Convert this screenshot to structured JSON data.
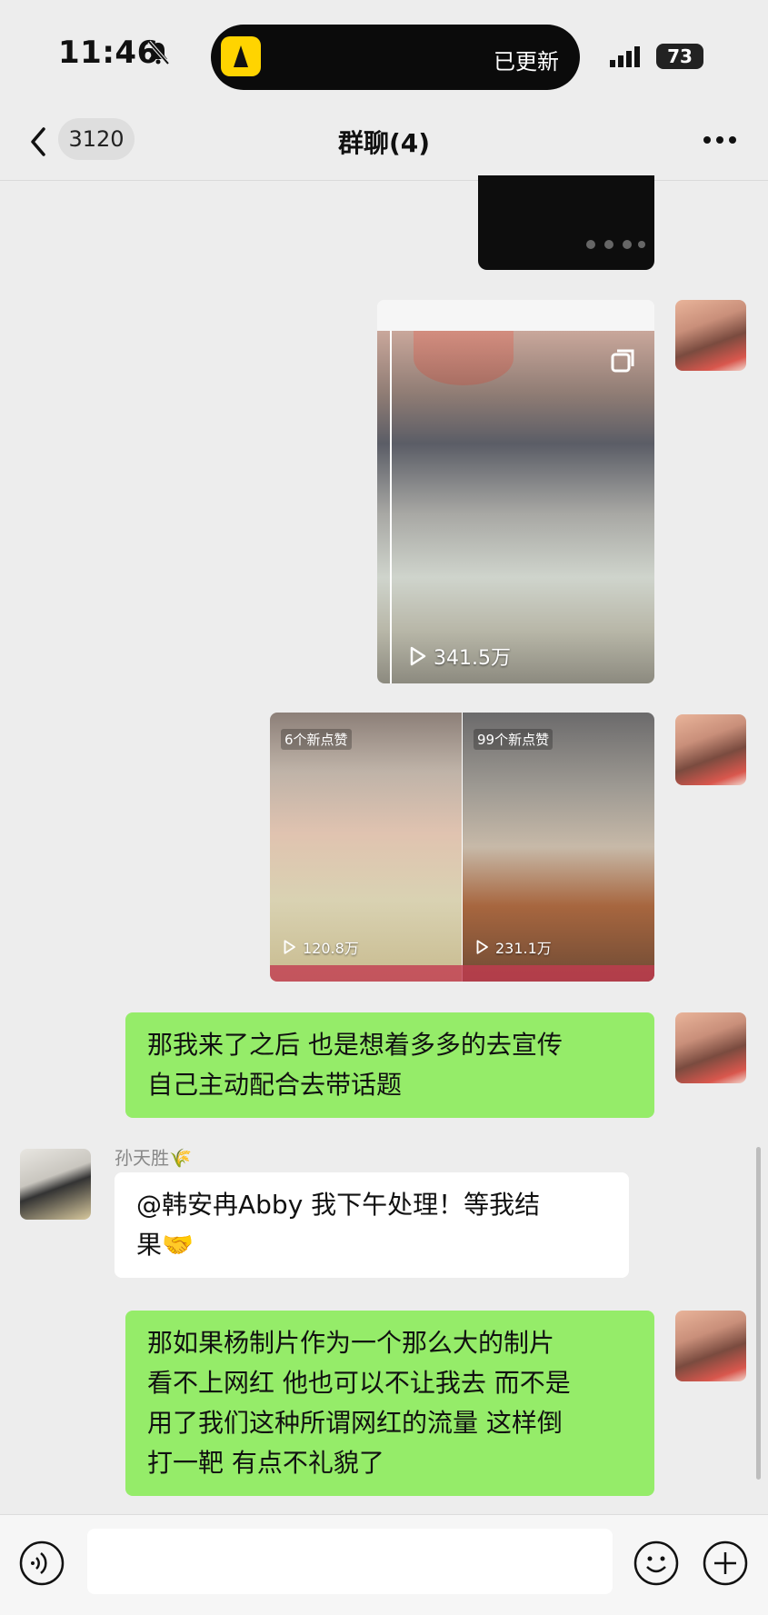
{
  "status": {
    "time": "11:46",
    "island_text": "已更新",
    "battery": "73"
  },
  "nav": {
    "unread_count": "3120",
    "title": "群聊(4)"
  },
  "messages": {
    "video1": {
      "views": "341.5万"
    },
    "video2": {
      "like_tag": "6个新点赞",
      "views": "120.8万"
    },
    "video3": {
      "like_tag": "99个新点赞",
      "views": "231.1万"
    },
    "msg1": {
      "lines": [
        "那我来了之后 也是想着多多的去宣传",
        "自己主动配合去带话题"
      ]
    },
    "msg2": {
      "sender": "孙天胜🌾",
      "lines": [
        "@韩安冉Abby 我下午处理！等我结",
        "果🤝"
      ]
    },
    "msg3": {
      "lines": [
        "那如果杨制片作为一个那么大的制片",
        "看不上网红 他也可以不让我去 而不是",
        "用了我们这种所谓网红的流量 这样倒",
        "打一靶 有点不礼貌了"
      ]
    }
  },
  "colors": {
    "bubble_green": "#95ec69",
    "background": "#ededed"
  }
}
